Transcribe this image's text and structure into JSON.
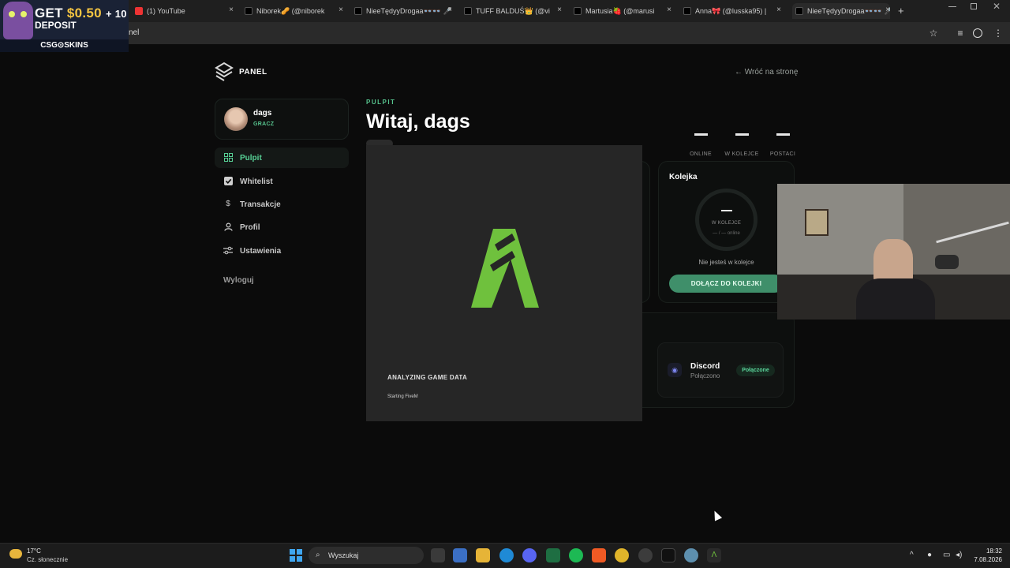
{
  "browser": {
    "tabs": [
      {
        "title": "(1) YouTube",
        "close": "×"
      },
      {
        "title": "Niborek🥜 (@niborek",
        "close": "×"
      },
      {
        "title": "NieeTędyyDrogaa👓👓 🎤",
        "close": "×"
      },
      {
        "title": "TUFF BALDUŚ👑 (@vi",
        "close": "×"
      },
      {
        "title": "Martusia🍓 (@marusi",
        "close": "×"
      },
      {
        "title": "Anna🎀 (@lusska95) |",
        "close": "×"
      },
      {
        "title": "NieeTędyyDrogaa👓👓 🎤",
        "close": "×"
      }
    ],
    "new_tab": "+",
    "url": "nel"
  },
  "ad": {
    "get": "GET",
    "amount": "$0.50",
    "plus": "+ 10",
    "deposit": "DEPOSIT",
    "brand": "CSG⊙SKINS"
  },
  "panel": {
    "logo_text": "PANEL",
    "back_link": "← Wróć na stronę",
    "user": {
      "name": "dags",
      "role": "GRACZ"
    },
    "nav": [
      {
        "label": "Pulpit",
        "icon": "grid-icon"
      },
      {
        "label": "Whitelist",
        "icon": "checkbox-icon"
      },
      {
        "label": "Transakcje",
        "icon": "dollar-icon"
      },
      {
        "label": "Profil",
        "icon": "user-icon"
      },
      {
        "label": "Ustawienia",
        "icon": "sliders-icon"
      }
    ],
    "logout": "Wyloguj",
    "eyebrow": "PULPIT",
    "heading": "Witaj, dags",
    "stats": [
      {
        "label": "ONLINE"
      },
      {
        "label": "W KOLEJCE"
      },
      {
        "label": "POSTACI"
      }
    ],
    "queue": {
      "title": "Kolejka",
      "ring_label": "W KOLEJCE",
      "ring_sub": "— / — online",
      "status": "Nie jesteś w kolejce",
      "join_button": "DOŁĄCZ DO KOLEJKI"
    },
    "discord": {
      "name": "Discord",
      "sub": "Połączono",
      "badge": "Połączone"
    }
  },
  "fivem": {
    "status_title": "ANALYZING GAME DATA",
    "status_sub": "Starting FiveM",
    "logo_color": "#6fc13d"
  },
  "taskbar": {
    "weather_temp": "17°C",
    "weather_cond": "Cz. słonecznie",
    "search_placeholder": "Wyszukaj",
    "time": "18:32",
    "date": "7.08.2026",
    "apps": [
      "task-view-icon",
      "store-icon",
      "files-icon",
      "edge-icon",
      "discord-icon",
      "excel-icon",
      "spotify-icon",
      "brave-icon",
      "chrome-icon",
      "chrome-alt-icon",
      "tiktok-icon",
      "app-icon",
      "fivem-icon"
    ]
  },
  "colors": {
    "accent": "#57c48e",
    "join_button": "#3f8f6a",
    "background": "#0b0b0b"
  }
}
